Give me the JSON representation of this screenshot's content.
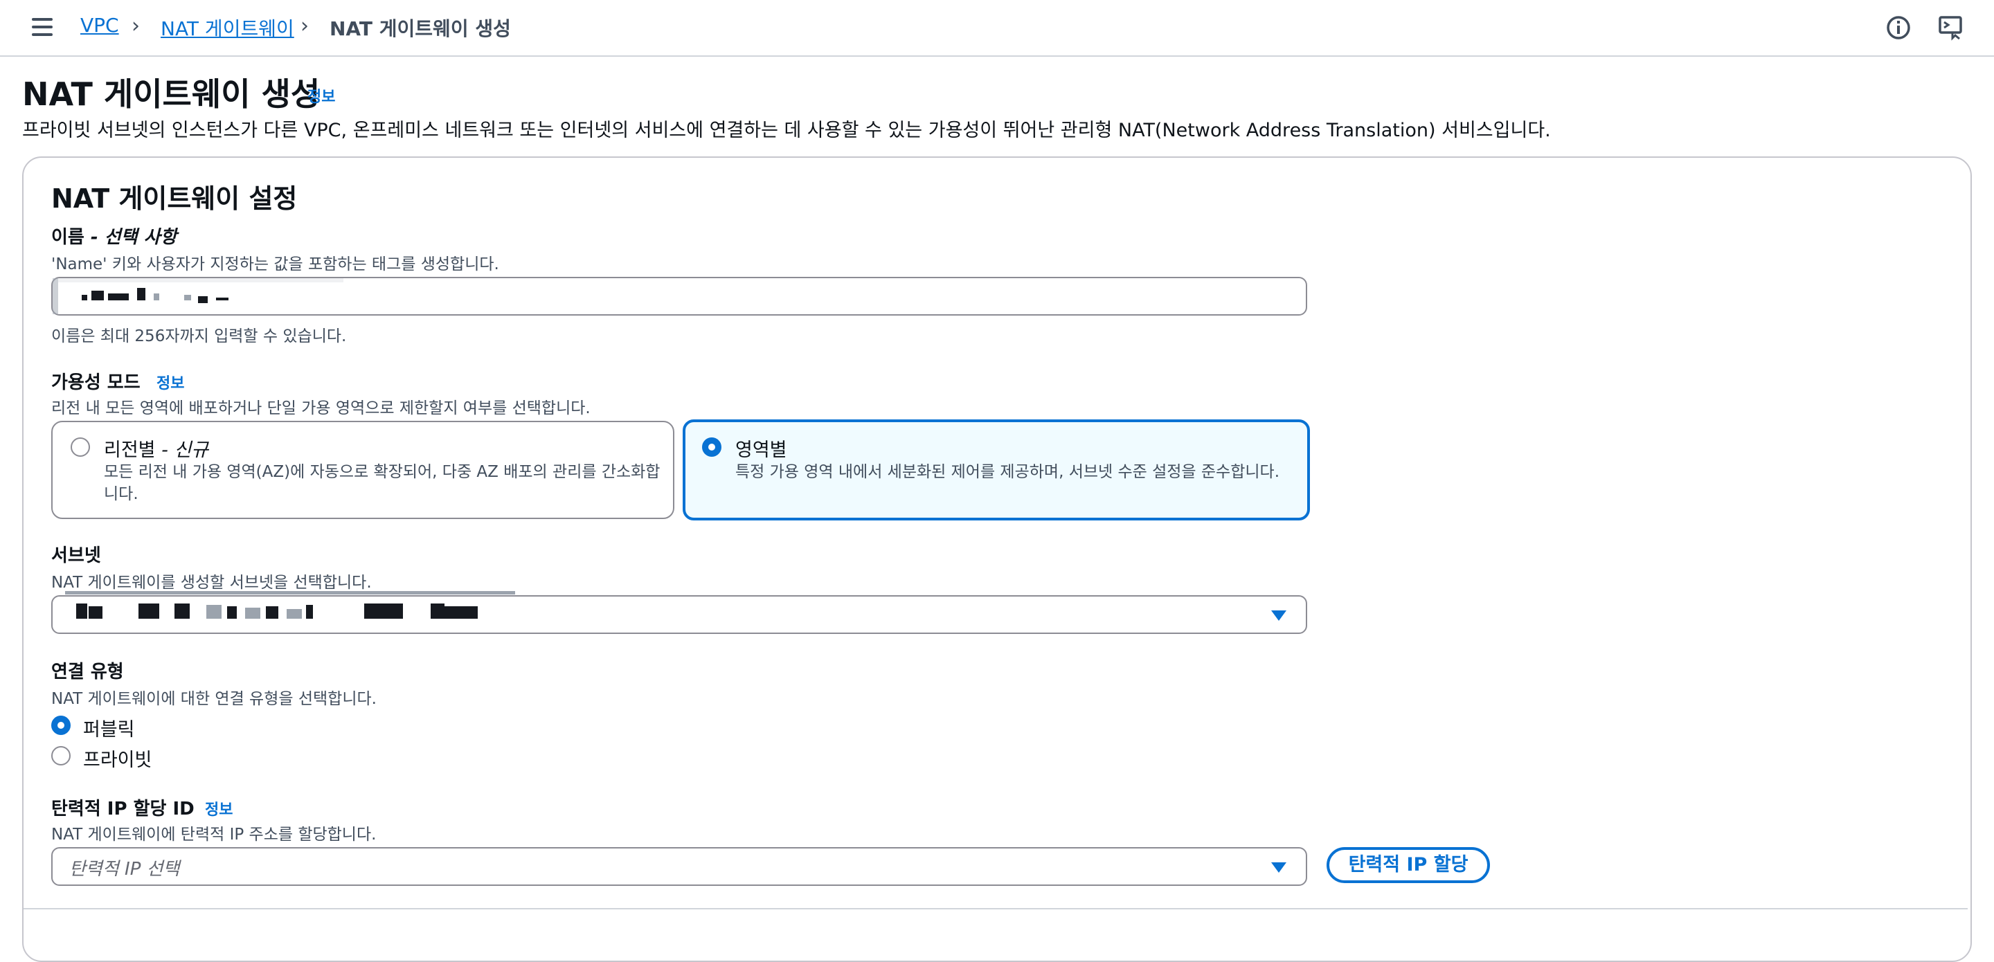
{
  "breadcrumb": {
    "items": [
      "VPC",
      "NAT 게이트웨이"
    ],
    "current": "NAT 게이트웨이 생성"
  },
  "header_icons": [
    "info-circle-icon",
    "feedback-monitor-icon"
  ],
  "page": {
    "title": "NAT 게이트웨이 생성",
    "info_link": "정보",
    "description": "프라이빗 서브넷의 인스턴스가 다른 VPC, 온프레미스 네트워크 또는 인터넷의 서비스에 연결하는 데 사용할 수 있는 가용성이 뛰어난 관리형 NAT(Network Address Translation) 서비스입니다."
  },
  "panel": {
    "title": "NAT 게이트웨이 설정",
    "name": {
      "label": "이름",
      "label_suffix": "- 선택 사항",
      "description": "'Name' 키와 사용자가 지정하는 값을 포함하는 태그를 생성합니다.",
      "value": "[redacted]",
      "hint": "이름은 최대 256자까지 입력할 수 있습니다."
    },
    "availability": {
      "label": "가용성 모드",
      "info_link": "정보",
      "description": "리전 내 모든 영역에 배포하거나 단일 가용 영역으로 제한할지 여부를 선택합니다.",
      "options": [
        {
          "title": "리전별",
          "title_suffix": "- 신규",
          "desc_line1": "모든 리전 내 가용 영역(AZ)에 자동으로 확장되어, 다중 AZ 배포의 관리를 간소화합",
          "desc_line2": "니다.",
          "selected": false
        },
        {
          "title": "영역별",
          "desc_line1": "특정 가용 영역 내에서 세분화된 제어를 제공하며, 서브넷 수준 설정을 준수합니다.",
          "selected": true
        }
      ]
    },
    "subnet": {
      "label": "서브넷",
      "description": "NAT 게이트웨이를 생성할 서브넷을 선택합니다.",
      "value": "[redacted]"
    },
    "connectivity": {
      "label": "연결 유형",
      "description": "NAT 게이트웨이에 대한 연결 유형을 선택합니다.",
      "options": [
        {
          "label": "퍼블릭",
          "selected": true
        },
        {
          "label": "프라이빗",
          "selected": false
        }
      ]
    },
    "eip": {
      "label": "탄력적 IP 할당 ID",
      "info_link": "정보",
      "description": "NAT 게이트웨이에 탄력적 IP 주소를 할당합니다.",
      "placeholder": "탄력적 IP 선택",
      "allocate_button": "탄력적 IP 할당"
    }
  },
  "colors": {
    "accent": "#0972d3",
    "selected_card_bg": "#f0fbff",
    "text": "#0f141a",
    "muted": "#414d5c",
    "border": "#8c8c94"
  }
}
